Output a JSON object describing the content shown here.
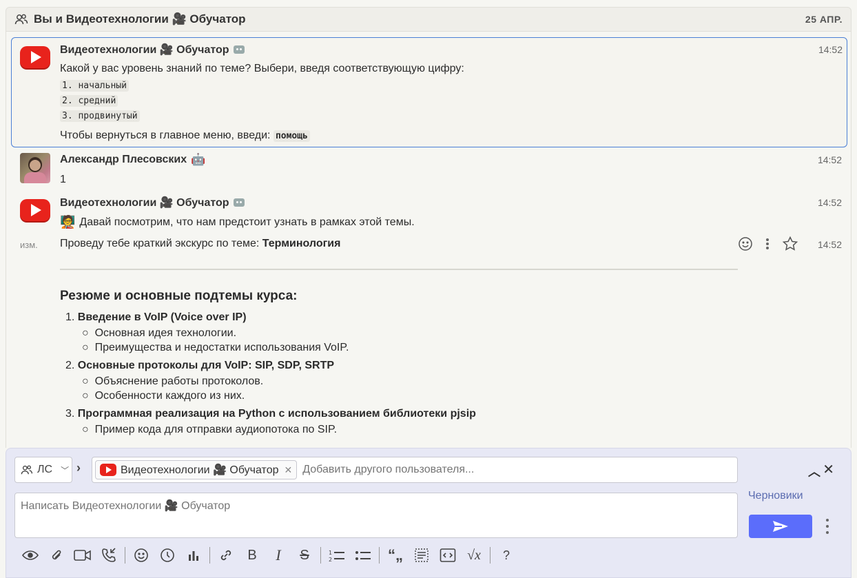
{
  "header": {
    "title": "Вы и Видеотехнологии 🎥 Обучатор",
    "date": "25 АПР."
  },
  "messages": [
    {
      "sender": "Видеотехнологии 🎥 Обучатор",
      "time": "14:52",
      "intro": "Какой у вас уровень знаний по теме? Выбери, введя соответствующую цифру:",
      "options": [
        "1. начальный",
        "2. средний",
        "3. продвинутый"
      ],
      "footer_text": "Чтобы вернуться в главное меню, введи:",
      "footer_code": "помощь"
    },
    {
      "sender": "Александр Плесовских",
      "time": "14:52",
      "text": "1"
    },
    {
      "sender": "Видеотехнологии 🎥 Обучатор",
      "time": "14:52",
      "text": "Давай посмотрим, что нам предстоит узнать в рамках этой темы."
    },
    {
      "edited_label": "изм.",
      "time": "14:52",
      "text_prefix": "Проведу тебе краткий экскурс по теме: ",
      "text_bold": "Терминология",
      "heading": "Резюме и основные подтемы курса:",
      "topics": [
        {
          "num": "1.",
          "title": "Введение в VoIP (Voice over IP)",
          "items": [
            "Основная идея технологии.",
            "Преимущества и недостатки использования VoIP."
          ]
        },
        {
          "num": "2.",
          "title": "Основные протоколы для VoIP: SIP, SDP, SRTP",
          "items": [
            "Объяснение работы протоколов.",
            "Особенности каждого из них."
          ]
        },
        {
          "num": "3.",
          "title": "Программная реализация на Python с использованием библиотеки pjsip",
          "items": [
            "Пример кода для отправки аудиопотока по SIP."
          ]
        }
      ]
    }
  ],
  "compose": {
    "mode_label": "ЛС",
    "recipient": "Видеотехнологии 🎥 Обучатор",
    "add_user_placeholder": "Добавить другого пользователя...",
    "message_placeholder": "Написать Видеотехнологии 🎥 Обучатор",
    "drafts_label": "Черновики",
    "toolbar": [
      "eye-icon",
      "paperclip-icon",
      "video-icon",
      "phone-icon",
      "smile-icon",
      "clock-icon",
      "poll-icon",
      "link-icon",
      "bold-icon",
      "italic-icon",
      "strikethrough-icon",
      "numbered-list-icon",
      "bullet-list-icon",
      "quote-icon",
      "spoiler-icon",
      "code-icon",
      "math-icon",
      "help-icon"
    ],
    "toolbar_glyphs": {
      "bold": "B",
      "italic": "I",
      "strike": "S",
      "help": "?",
      "quote": "“„",
      "math": "√x"
    }
  },
  "colors": {
    "accent": "#5b6dfb",
    "youtube_red": "#e8231c",
    "selected_border": "#4a7fd6",
    "drafts_link": "#5b6cb0"
  }
}
